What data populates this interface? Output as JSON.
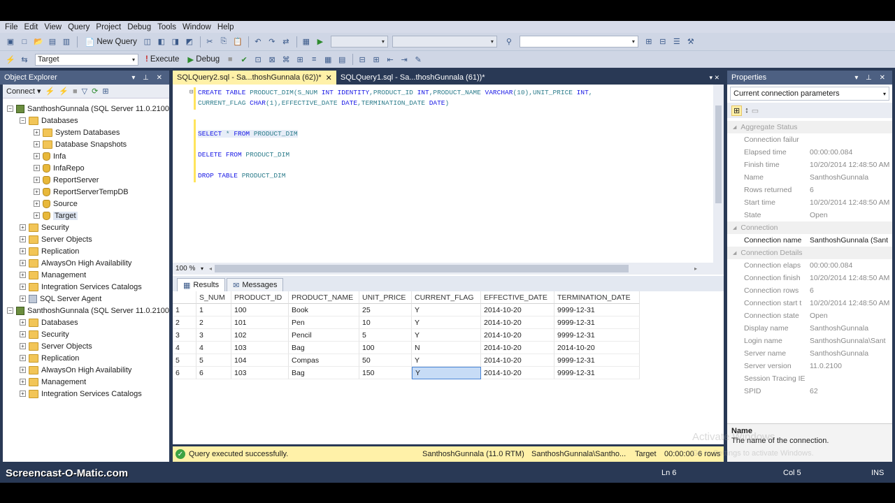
{
  "menu": [
    "File",
    "Edit",
    "View",
    "Query",
    "Project",
    "Debug",
    "Tools",
    "Window",
    "Help"
  ],
  "toolbar": {
    "new_query": "New Query",
    "db_combo": "Target",
    "execute": "Execute",
    "debug": "Debug"
  },
  "object_explorer": {
    "title": "Object Explorer",
    "connect": "Connect",
    "nodes": [
      "SanthoshGunnala (SQL Server 11.0.2100",
      "Databases",
      "System Databases",
      "Database Snapshots",
      "Infa",
      "InfaRepo",
      "ReportServer",
      "ReportServerTempDB",
      "Source",
      "Target",
      "Security",
      "Server Objects",
      "Replication",
      "AlwaysOn High Availability",
      "Management",
      "Integration Services Catalogs",
      "SQL Server Agent",
      "SanthoshGunnala (SQL Server 11.0.2100",
      "Databases",
      "Security",
      "Server Objects",
      "Replication",
      "AlwaysOn High Availability",
      "Management",
      "Integration Services Catalogs"
    ]
  },
  "tabs": [
    "SQLQuery2.sql - Sa...thoshGunnala (62))*",
    "SQLQuery1.sql - Sa...thoshGunnala (61))*"
  ],
  "editor": {
    "l1a": "CREATE TABLE",
    "l1b": " PRODUCT_DIM(S_NUM ",
    "l1c": "INT IDENTITY",
    "l1d": ",PRODUCT_ID ",
    "l1e": "INT",
    "l1f": ",PRODUCT_NAME ",
    "l1g": "VARCHAR",
    "l1h": "(10),UNIT_PRICE ",
    "l1i": "INT",
    "l2a": "CURRENT_FLAG ",
    "l2b": "CHAR",
    "l2c": "(1),EFFECTIVE_DATE ",
    "l2d": "DATE",
    "l2e": ",TERMINATION_DATE ",
    "l2f": "DATE",
    "l3a": "SELECT",
    "l3b": " * ",
    "l3c": "FROM",
    "l3d": " PRODUCT_DIM",
    "l4a": "DELETE FROM",
    "l4b": " PRODUCT_DIM",
    "l5a": "DROP TABLE",
    "l5b": " PRODUCT_DIM"
  },
  "zoom": "100 %",
  "results_tabs": [
    "Results",
    "Messages"
  ],
  "grid": {
    "columns": [
      "S_NUM",
      "PRODUCT_ID",
      "PRODUCT_NAME",
      "UNIT_PRICE",
      "CURRENT_FLAG",
      "EFFECTIVE_DATE",
      "TERMINATION_DATE"
    ],
    "rows": [
      [
        "1",
        "1",
        "100",
        "Book",
        "25",
        "Y",
        "2014-10-20",
        "9999-12-31"
      ],
      [
        "2",
        "2",
        "101",
        "Pen",
        "10",
        "Y",
        "2014-10-20",
        "9999-12-31"
      ],
      [
        "3",
        "3",
        "102",
        "Pencil",
        "5",
        "Y",
        "2014-10-20",
        "9999-12-31"
      ],
      [
        "4",
        "4",
        "103",
        "Bag",
        "100",
        "N",
        "2014-10-20",
        "2014-10-20"
      ],
      [
        "5",
        "5",
        "104",
        "Compas",
        "50",
        "Y",
        "2014-10-20",
        "9999-12-31"
      ],
      [
        "6",
        "6",
        "103",
        "Bag",
        "150",
        "Y",
        "2014-10-20",
        "9999-12-31"
      ]
    ]
  },
  "status": {
    "message": "Query executed successfully.",
    "server": "SanthoshGunnala (11.0 RTM)",
    "user": "SanthoshGunnala\\Santho...",
    "db": "Target",
    "time": "00:00:00",
    "rows": "6 rows"
  },
  "properties": {
    "title": "Properties",
    "combo": "Current connection parameters",
    "cat1": "Aggregate Status",
    "cat2": "Connection",
    "cat3": "Connection Details",
    "rows_agg": [
      [
        "Connection failur",
        ""
      ],
      [
        "Elapsed time",
        "00:00:00.084"
      ],
      [
        "Finish time",
        "10/20/2014 12:48:50 AM"
      ],
      [
        "Name",
        "SanthoshGunnala"
      ],
      [
        "Rows returned",
        "6"
      ],
      [
        "Start time",
        "10/20/2014 12:48:50 AM"
      ],
      [
        "State",
        "Open"
      ]
    ],
    "conn_name_k": "Connection name",
    "conn_name_v": "SanthoshGunnala (Sant",
    "rows_det": [
      [
        "Connection elaps",
        "00:00:00.084"
      ],
      [
        "Connection finish",
        "10/20/2014 12:48:50 AM"
      ],
      [
        "Connection rows",
        "6"
      ],
      [
        "Connection start t",
        "10/20/2014 12:48:50 AM"
      ],
      [
        "Connection state",
        "Open"
      ],
      [
        "Display name",
        "SanthoshGunnala"
      ],
      [
        "Login name",
        "SanthoshGunnala\\Sant"
      ],
      [
        "Server name",
        "SanthoshGunnala"
      ],
      [
        "Server version",
        "11.0.2100"
      ],
      [
        "Session Tracing IE",
        ""
      ],
      [
        "SPID",
        "62"
      ]
    ],
    "desc_title": "Name",
    "desc_text": "The name of the connection.",
    "watermark1": "Activate Windows",
    "watermark2": "Go to Settings to activate Windows."
  },
  "bottom": {
    "brand": "Screencast-O-Matic.com",
    "ln": "Ln 6",
    "col": "Col 5",
    "ins": "INS"
  }
}
